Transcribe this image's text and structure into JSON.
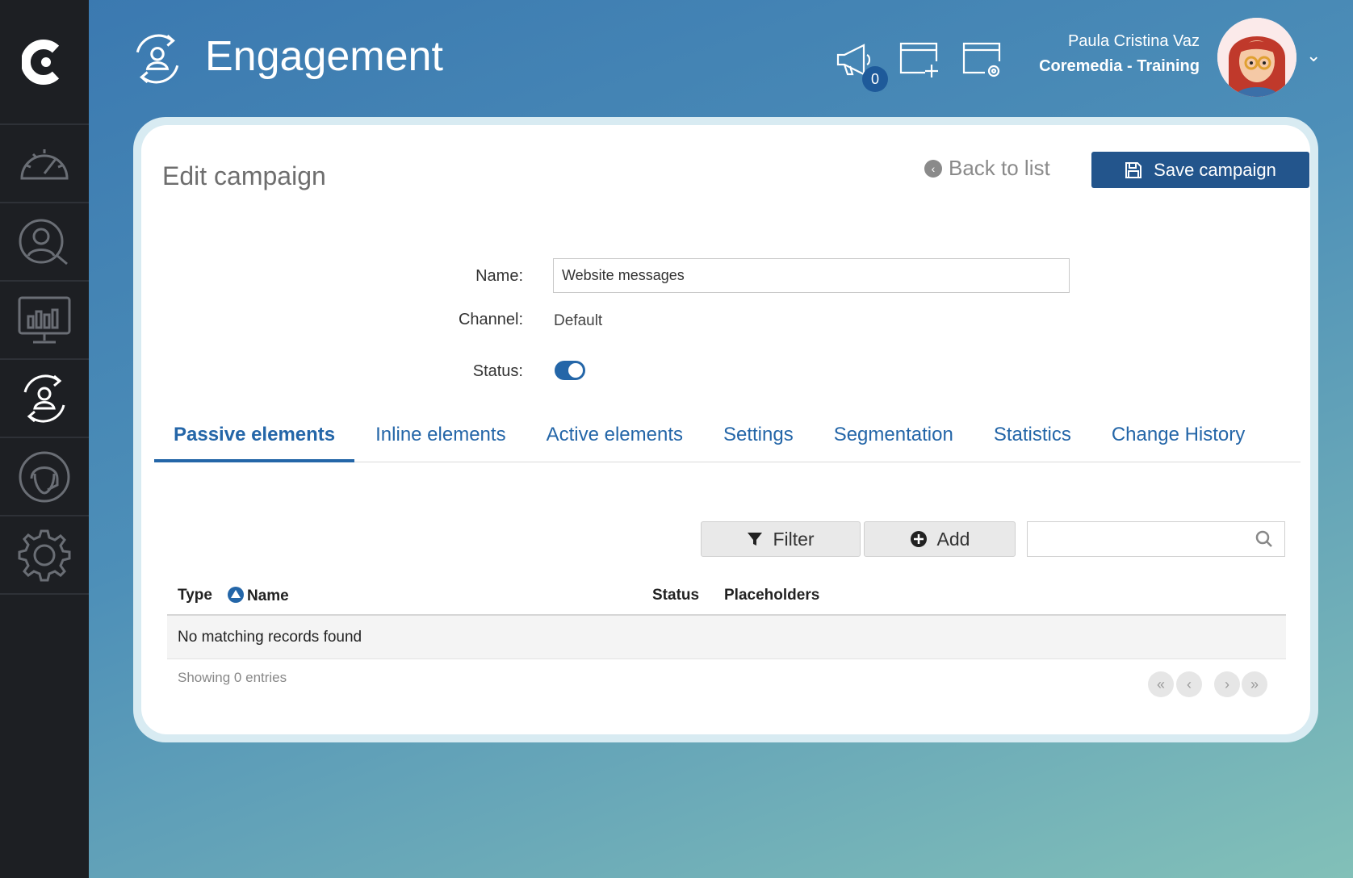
{
  "app": {
    "title": "Engagement"
  },
  "header": {
    "notifications_count": "0",
    "user_name": "Paula Cristina Vaz",
    "user_org": "Coremedia - Training"
  },
  "sidebar": {
    "items": [
      {
        "name": "dashboard",
        "icon": "speedometer-icon"
      },
      {
        "name": "user-search",
        "icon": "user-search-icon"
      },
      {
        "name": "analytics",
        "icon": "monitor-chart-icon"
      },
      {
        "name": "engagement",
        "icon": "user-cycle-icon",
        "active": true
      },
      {
        "name": "support",
        "icon": "headset-icon"
      },
      {
        "name": "settings",
        "icon": "gear-icon"
      }
    ]
  },
  "page": {
    "title": "Edit campaign",
    "back_label": "Back to list",
    "save_label": "Save campaign"
  },
  "form": {
    "name_label": "Name:",
    "name_value": "Website messages",
    "channel_label": "Channel:",
    "channel_value": "Default",
    "status_label": "Status:",
    "status_on": true
  },
  "tabs": [
    {
      "label": "Passive elements",
      "active": true
    },
    {
      "label": "Inline elements"
    },
    {
      "label": "Active elements"
    },
    {
      "label": "Settings"
    },
    {
      "label": "Segmentation"
    },
    {
      "label": "Statistics"
    },
    {
      "label": "Change History"
    }
  ],
  "toolbar": {
    "filter_label": "Filter",
    "add_label": "Add",
    "search_placeholder": ""
  },
  "table": {
    "columns": [
      "Type",
      "Name",
      "Status",
      "Placeholders"
    ],
    "empty_message": "No matching records found",
    "footer": "Showing 0 entries"
  },
  "colors": {
    "primary": "#23558c",
    "link": "#2466a8",
    "sidebar_bg": "#1d1f23"
  }
}
